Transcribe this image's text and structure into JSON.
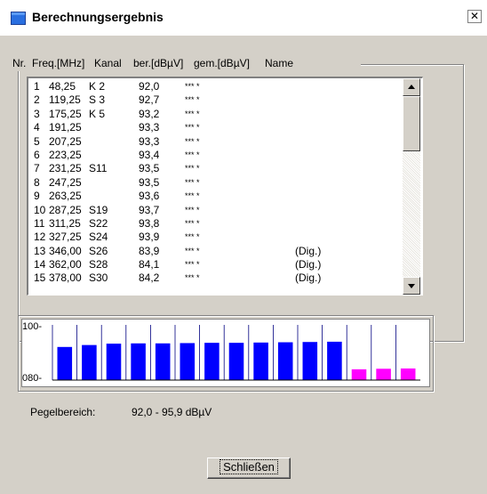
{
  "window": {
    "title": "Berechnungsergebnis",
    "close_glyph": "✕"
  },
  "table": {
    "headers": {
      "nr": "Nr.",
      "freq": "Freq.[MHz]",
      "kanal": "Kanal",
      "ber": "ber.[dBµV]",
      "gem": "gem.[dBµV]",
      "name": "Name"
    },
    "rows": [
      {
        "nr": "1",
        "freq": "48,25",
        "kanal": "K 2",
        "ber": "92,0",
        "gem": "*** *",
        "name": ""
      },
      {
        "nr": "2",
        "freq": "119,25",
        "kanal": "S 3",
        "ber": "92,7",
        "gem": "*** *",
        "name": ""
      },
      {
        "nr": "3",
        "freq": "175,25",
        "kanal": "K 5",
        "ber": "93,2",
        "gem": "*** *",
        "name": ""
      },
      {
        "nr": "4",
        "freq": "191,25",
        "kanal": "",
        "ber": "93,3",
        "gem": "*** *",
        "name": ""
      },
      {
        "nr": "5",
        "freq": "207,25",
        "kanal": "",
        "ber": "93,3",
        "gem": "*** *",
        "name": ""
      },
      {
        "nr": "6",
        "freq": "223,25",
        "kanal": "",
        "ber": "93,4",
        "gem": "*** *",
        "name": ""
      },
      {
        "nr": "7",
        "freq": "231,25",
        "kanal": "S11",
        "ber": "93,5",
        "gem": "*** *",
        "name": ""
      },
      {
        "nr": "8",
        "freq": "247,25",
        "kanal": "",
        "ber": "93,5",
        "gem": "*** *",
        "name": ""
      },
      {
        "nr": "9",
        "freq": "263,25",
        "kanal": "",
        "ber": "93,6",
        "gem": "*** *",
        "name": ""
      },
      {
        "nr": "10",
        "freq": "287,25",
        "kanal": "S19",
        "ber": "93,7",
        "gem": "*** *",
        "name": ""
      },
      {
        "nr": "11",
        "freq": "311,25",
        "kanal": "S22",
        "ber": "93,8",
        "gem": "*** *",
        "name": ""
      },
      {
        "nr": "12",
        "freq": "327,25",
        "kanal": "S24",
        "ber": "93,9",
        "gem": "*** *",
        "name": ""
      },
      {
        "nr": "13",
        "freq": "346,00",
        "kanal": "S26",
        "ber": "83,9",
        "gem": "*** *",
        "name": "(Dig.)"
      },
      {
        "nr": "14",
        "freq": "362,00",
        "kanal": "S28",
        "ber": "84,1",
        "gem": "*** *",
        "name": "(Dig.)"
      },
      {
        "nr": "15",
        "freq": "378,00",
        "kanal": "S30",
        "ber": "84,2",
        "gem": "*** *",
        "name": "(Dig.)"
      }
    ]
  },
  "chart": {
    "y_top_label": "100-",
    "y_bottom_label": "080-",
    "colors": {
      "bar": "#0000ff",
      "highlight": "#ff00ff",
      "divider": "#000080"
    }
  },
  "chart_data": {
    "type": "bar",
    "ylim": [
      80,
      100
    ],
    "ytick_labels": [
      "100-",
      "080-"
    ],
    "series": [
      {
        "values": [
          92.0,
          92.7,
          93.2,
          93.3,
          93.3,
          93.4,
          93.5,
          93.5,
          93.6,
          93.7,
          93.8,
          93.9,
          83.9,
          84.1,
          84.2
        ]
      }
    ]
  },
  "footer": {
    "range_label": "Pegelbereich:",
    "range_value": "92,0 - 95,9 dBµV",
    "close_button": "Schließen"
  }
}
